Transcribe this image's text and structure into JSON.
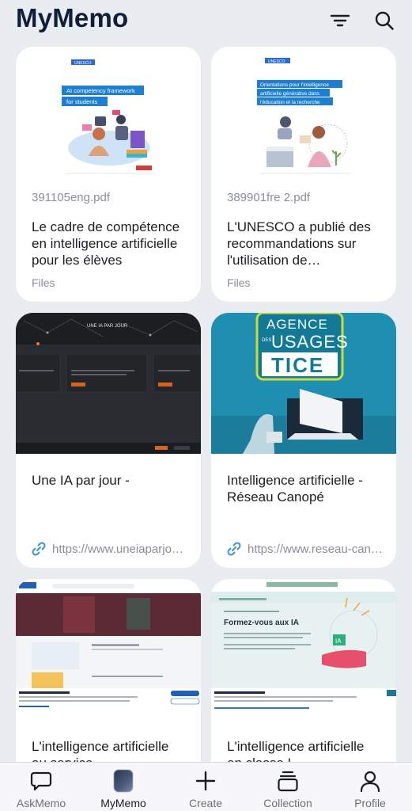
{
  "app": {
    "title": "MyMemo"
  },
  "header": {
    "filter_icon": "filter-icon",
    "search_icon": "search-icon"
  },
  "cards": [
    {
      "filename": "391105eng.pdf",
      "title": "Le cadre de compétence en intelligence artificielle pour les élèves",
      "source": "Files",
      "thumb": {
        "publisher": "UNESCO",
        "heading_line1": "AI competency framework",
        "heading_line2": "for students"
      }
    },
    {
      "filename": "389901fre 2.pdf",
      "title": "L'UNESCO a publié des recommandations sur l'utilisation de l'intelligence artificielle générative",
      "source": "Files",
      "thumb": {
        "publisher": "UNESCO",
        "heading_line1": "Orientations pour l'intelligence",
        "heading_line2": "artificielle générative dans",
        "heading_line3": "l'éducation et la recherche"
      }
    },
    {
      "title": "Une IA par jour -",
      "link": "https://www.uneiaparjour.fr",
      "thumb": {
        "site_title": "UNE IA PAR JOUR"
      }
    },
    {
      "title": "Intelligence artificielle - Réseau Canopé",
      "link": "https://www.reseau-canope.fr",
      "thumb": {
        "line1": "AGENCE",
        "line2_small": "DES",
        "line2": "USAGES",
        "line3": "TICE"
      }
    },
    {
      "title": "L'intelligence artificielle au service",
      "thumb": {}
    },
    {
      "title": "L'intelligence artificielle en classe !",
      "thumb": {
        "heading": "Formez-vous aux IA",
        "badge": "IA"
      }
    }
  ],
  "nav": [
    {
      "label": "AskMemo",
      "icon": "chat-bubble-icon"
    },
    {
      "label": "MyMemo",
      "icon": "memo-avatar",
      "active": true
    },
    {
      "label": "Create",
      "icon": "plus-icon"
    },
    {
      "label": "Collection",
      "icon": "collection-icon"
    },
    {
      "label": "Profile",
      "icon": "person-icon"
    }
  ],
  "colors": {
    "background": "#e9edf1",
    "card": "#ffffff",
    "link": "#3d8fe0",
    "title": "#0f1f3a"
  }
}
